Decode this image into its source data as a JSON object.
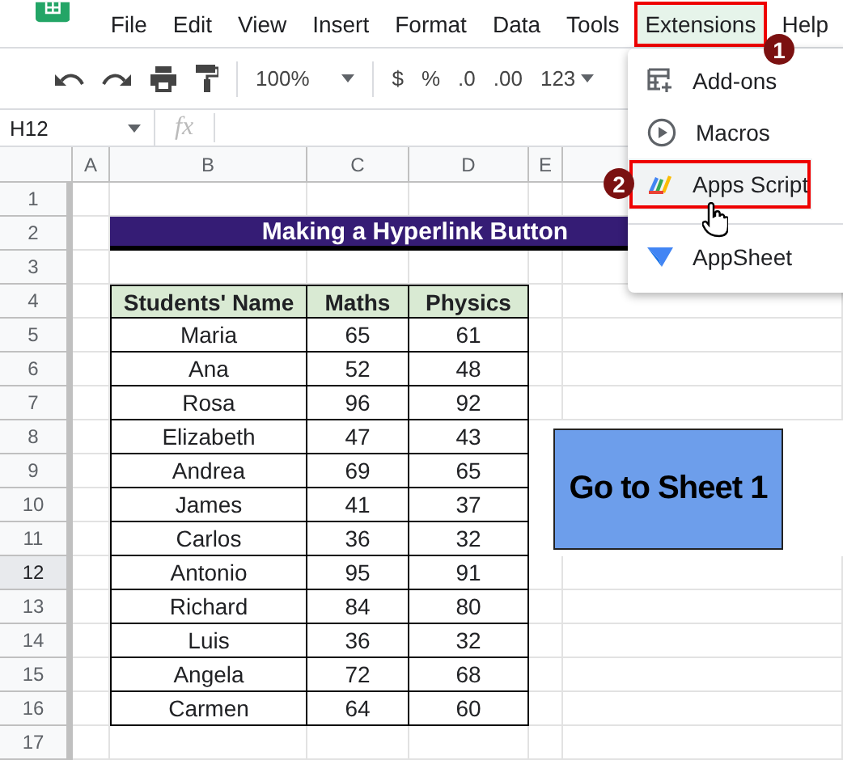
{
  "menu_bar": [
    {
      "label": "File",
      "selected": false
    },
    {
      "label": "Edit",
      "selected": false
    },
    {
      "label": "View",
      "selected": false
    },
    {
      "label": "Insert",
      "selected": false
    },
    {
      "label": "Format",
      "selected": false
    },
    {
      "label": "Data",
      "selected": false
    },
    {
      "label": "Tools",
      "selected": false
    },
    {
      "label": "Extensions",
      "selected": true
    },
    {
      "label": "Help",
      "selected": false
    }
  ],
  "toolbar": {
    "zoom": "100%",
    "currency": "$",
    "percent": "%",
    "decrease_decimal": ".0",
    "increase_decimal": ".00",
    "number_format": "123"
  },
  "formula_bar": {
    "name_box": "H12",
    "fx": "fx"
  },
  "sheet": {
    "columns": [
      "A",
      "B",
      "C",
      "D",
      "E"
    ],
    "rows": [
      {
        "number": "1",
        "selected": false
      },
      {
        "number": "2",
        "selected": false
      },
      {
        "number": "3",
        "selected": false
      },
      {
        "number": "4",
        "selected": false
      },
      {
        "number": "5",
        "selected": false
      },
      {
        "number": "6",
        "selected": false
      },
      {
        "number": "7",
        "selected": false
      },
      {
        "number": "8",
        "selected": false
      },
      {
        "number": "9",
        "selected": false
      },
      {
        "number": "10",
        "selected": false
      },
      {
        "number": "11",
        "selected": false
      },
      {
        "number": "12",
        "selected": true
      },
      {
        "number": "13",
        "selected": false
      },
      {
        "number": "14",
        "selected": false
      },
      {
        "number": "15",
        "selected": false
      },
      {
        "number": "16",
        "selected": false
      },
      {
        "number": "17",
        "selected": false
      }
    ],
    "title": "Making a Hyperlink Button",
    "table": {
      "columns": [
        "Students' Name",
        "Maths",
        "Physics"
      ],
      "rows": [
        [
          "Maria",
          "65",
          "61"
        ],
        [
          "Ana",
          "52",
          "48"
        ],
        [
          "Rosa",
          "96",
          "92"
        ],
        [
          "Elizabeth",
          "47",
          "43"
        ],
        [
          "Andrea",
          "69",
          "65"
        ],
        [
          "James",
          "41",
          "37"
        ],
        [
          "Carlos",
          "36",
          "32"
        ],
        [
          "Antonio",
          "95",
          "91"
        ],
        [
          "Richard",
          "84",
          "80"
        ],
        [
          "Luis",
          "36",
          "32"
        ],
        [
          "Angela",
          "72",
          "68"
        ],
        [
          "Carmen",
          "64",
          "60"
        ]
      ]
    },
    "button": "Go to Sheet 1"
  },
  "extensions_menu": [
    {
      "label": "Add-ons",
      "selected": false,
      "separator_above": false
    },
    {
      "label": "Macros",
      "selected": false,
      "separator_above": false
    },
    {
      "label": "Apps Script",
      "selected": true,
      "separator_above": false
    },
    {
      "label": "AppSheet",
      "selected": false,
      "separator_above": true
    }
  ],
  "annotations": [
    {
      "label": "1"
    },
    {
      "label": "2"
    }
  ]
}
